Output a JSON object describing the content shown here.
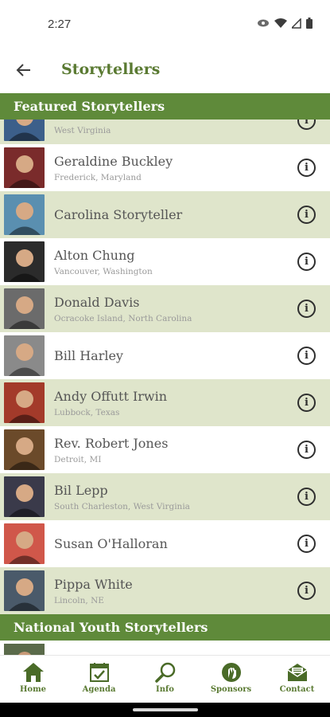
{
  "status_bar": {
    "time": "2:27"
  },
  "app_bar": {
    "title": "Storytellers"
  },
  "sections": {
    "featured": "Featured Storytellers",
    "youth": "National Youth Storytellers"
  },
  "storytellers": [
    {
      "name": "",
      "location": "West Virginia",
      "shaded": true,
      "thumb": "#3c5f8a"
    },
    {
      "name": "Geraldine Buckley",
      "location": "Frederick, Maryland",
      "shaded": false,
      "thumb": "#7a2b2b"
    },
    {
      "name": "Carolina Storyteller",
      "location": "",
      "shaded": true,
      "thumb": "#5a8fb0"
    },
    {
      "name": "Alton Chung",
      "location": "Vancouver, Washington",
      "shaded": false,
      "thumb": "#2b2b2b"
    },
    {
      "name": "Donald Davis",
      "location": "Ocracoke Island, North Carolina",
      "shaded": true,
      "thumb": "#6b6b6b"
    },
    {
      "name": "Bill Harley",
      "location": "",
      "shaded": false,
      "thumb": "#8a8a8a"
    },
    {
      "name": "Andy Offutt Irwin",
      "location": "Lubbock, Texas",
      "shaded": true,
      "thumb": "#a33a2a"
    },
    {
      "name": "Rev. Robert Jones",
      "location": "Detroit, MI",
      "shaded": false,
      "thumb": "#6b4a2a"
    },
    {
      "name": "Bil Lepp",
      "location": "South Charleston, West Virginia",
      "shaded": true,
      "thumb": "#3a3a4a"
    },
    {
      "name": "Susan O'Halloran",
      "location": "",
      "shaded": false,
      "thumb": "#d0574a"
    },
    {
      "name": "Pippa White",
      "location": "Lincoln, NE",
      "shaded": true,
      "thumb": "#4a5a6a"
    }
  ],
  "bottom_nav": [
    {
      "label": "Home",
      "icon": "home-icon"
    },
    {
      "label": "Agenda",
      "icon": "agenda-icon"
    },
    {
      "label": "Info",
      "icon": "search-icon"
    },
    {
      "label": "Sponsors",
      "icon": "sponsors-icon"
    },
    {
      "label": "Contact",
      "icon": "mail-icon"
    }
  ],
  "colors": {
    "brand_green": "#5f8a3a",
    "title_green": "#5a7a32",
    "row_shade": "#dfe5cb"
  }
}
